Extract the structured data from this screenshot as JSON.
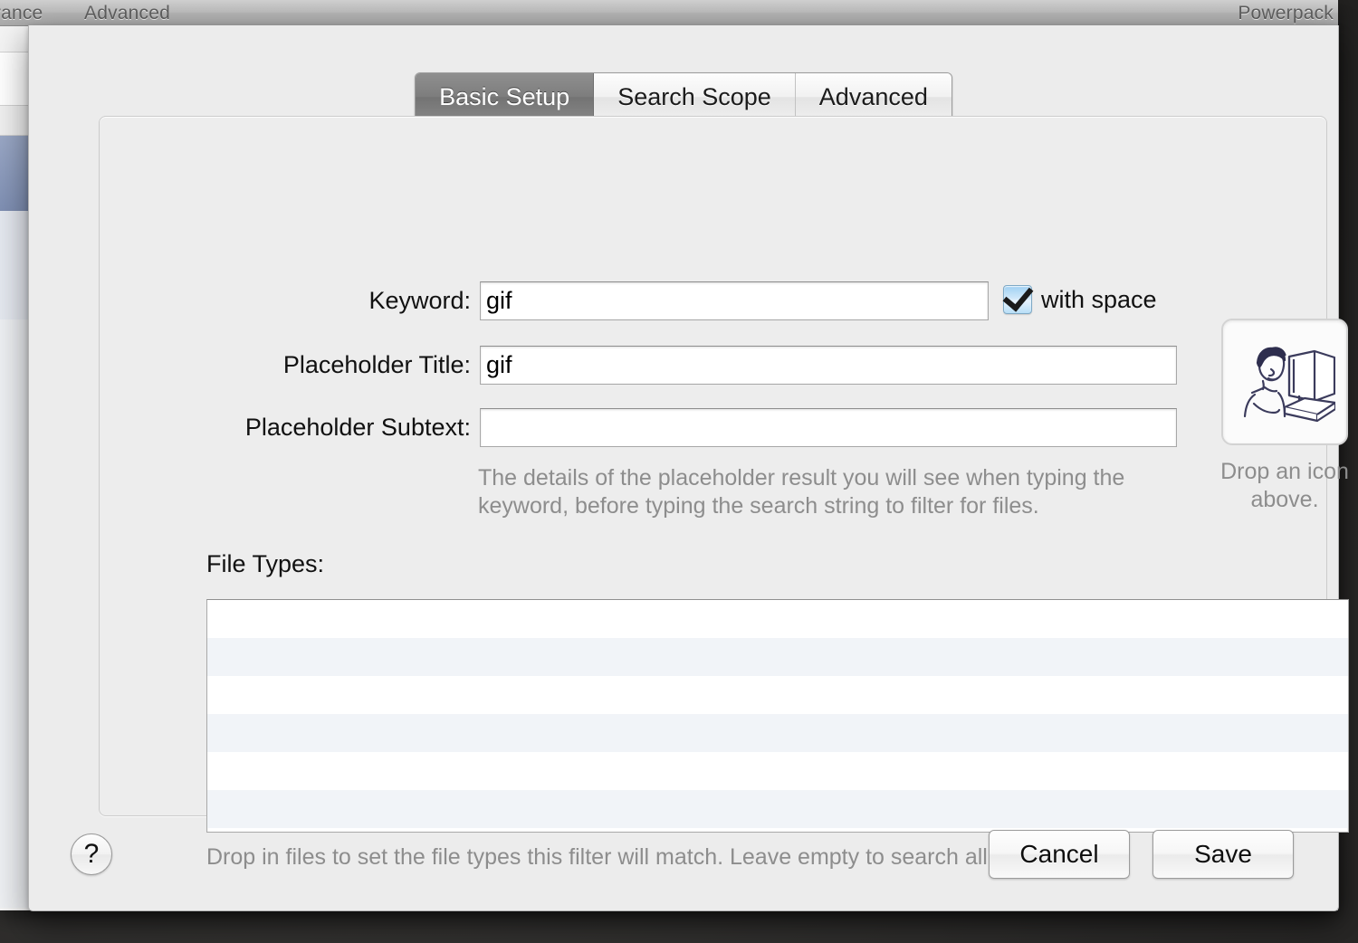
{
  "window": {
    "toolbar": {
      "appearance_label": "arance",
      "advanced_label": "Advanced",
      "powerpack_label": "Powerpack"
    }
  },
  "sheet": {
    "tabs": [
      {
        "label": "Basic Setup",
        "active": true
      },
      {
        "label": "Search Scope",
        "active": false
      },
      {
        "label": "Advanced",
        "active": false
      }
    ],
    "form": {
      "keyword": {
        "label": "Keyword:",
        "value": "gif",
        "placeholder": ""
      },
      "placeholder_title": {
        "label": "Placeholder Title:",
        "value": "gif",
        "placeholder": ""
      },
      "placeholder_subtext": {
        "label": "Placeholder Subtext:",
        "value": "",
        "placeholder": ""
      },
      "with_space": {
        "label": "with space",
        "checked": true
      },
      "help_text": "The details of the placeholder result you will see when typing the keyword, before typing the search string to filter for files."
    },
    "icon_well": {
      "caption": "Drop an icon above.",
      "icon_name": "person-at-computer-icon"
    },
    "file_types": {
      "label": "File Types:",
      "rows": [
        "",
        "",
        "",
        "",
        "",
        ""
      ],
      "hint": "Drop in files to set the file types this filter will match. Leave empty to search all file types."
    },
    "footer": {
      "help_label": "?",
      "cancel_label": "Cancel",
      "save_label": "Save"
    }
  },
  "colors": {
    "sheet_bg": "#ececec",
    "active_tab": "#7d7d7d",
    "checkbox_accent": "#9fd0f2",
    "muted_text": "#8d8d8d",
    "list_stripe": "#f1f4f8"
  }
}
